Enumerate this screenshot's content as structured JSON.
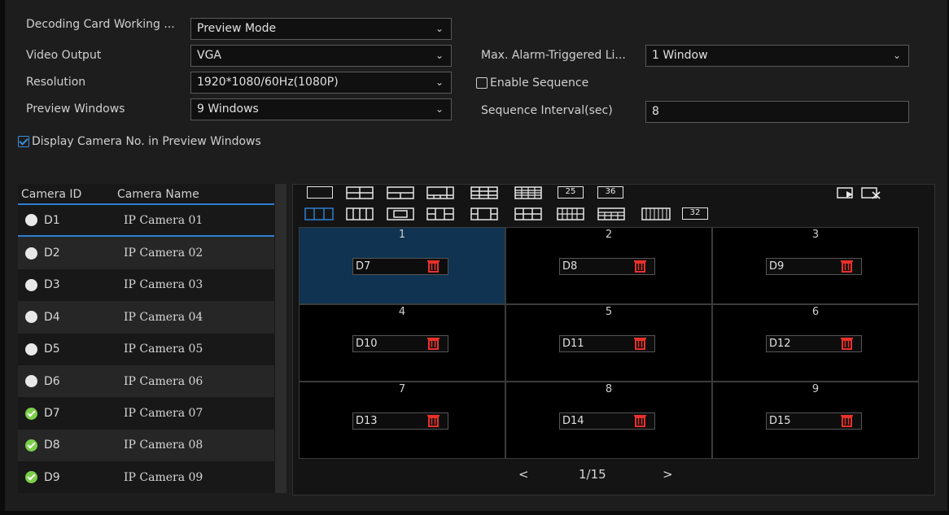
{
  "form": {
    "decoding_label": "Decoding Card Working ...",
    "decoding_value": "Preview Mode",
    "video_output_label": "Video Output",
    "video_output_value": "VGA",
    "resolution_label": "Resolution",
    "resolution_value": "1920*1080/60Hz(1080P)",
    "preview_windows_label": "Preview Windows",
    "preview_windows_value": "9 Windows",
    "max_alarm_label": "Max. Alarm-Triggered Li...",
    "max_alarm_value": "1 Window",
    "enable_sequence_label": "Enable Sequence",
    "sequence_interval_label": "Sequence Interval(sec)",
    "sequence_interval_value": "8",
    "display_camera_no_label": "Display Camera No. in Preview Windows"
  },
  "camera_table": {
    "headers": [
      "Camera ID",
      "Camera Name"
    ],
    "rows": [
      {
        "id": "D1",
        "name": "IP Camera 01",
        "assigned": false
      },
      {
        "id": "D2",
        "name": "IP Camera 02",
        "assigned": false
      },
      {
        "id": "D3",
        "name": "IP Camera 03",
        "assigned": false
      },
      {
        "id": "D4",
        "name": "IP Camera 04",
        "assigned": false
      },
      {
        "id": "D5",
        "name": "IP Camera 05",
        "assigned": false
      },
      {
        "id": "D6",
        "name": "IP Camera 06",
        "assigned": false
      },
      {
        "id": "D7",
        "name": "IP Camera 07",
        "assigned": true
      },
      {
        "id": "D8",
        "name": "IP Camera 08",
        "assigned": true
      },
      {
        "id": "D9",
        "name": "IP Camera 09",
        "assigned": true
      }
    ]
  },
  "layouts": {
    "label_25": "25",
    "label_36": "36",
    "label_32": "32"
  },
  "windows": [
    {
      "num": "1",
      "cam": "D7"
    },
    {
      "num": "2",
      "cam": "D8"
    },
    {
      "num": "3",
      "cam": "D9"
    },
    {
      "num": "4",
      "cam": "D10"
    },
    {
      "num": "5",
      "cam": "D11"
    },
    {
      "num": "6",
      "cam": "D12"
    },
    {
      "num": "7",
      "cam": "D13"
    },
    {
      "num": "8",
      "cam": "D14"
    },
    {
      "num": "9",
      "cam": "D15"
    }
  ],
  "pager": {
    "prev": "<",
    "page": "1/15",
    "next": ">"
  },
  "colors": {
    "accent": "#2e7fd0",
    "delete": "#e8312a",
    "online": "#7ccf4a"
  }
}
